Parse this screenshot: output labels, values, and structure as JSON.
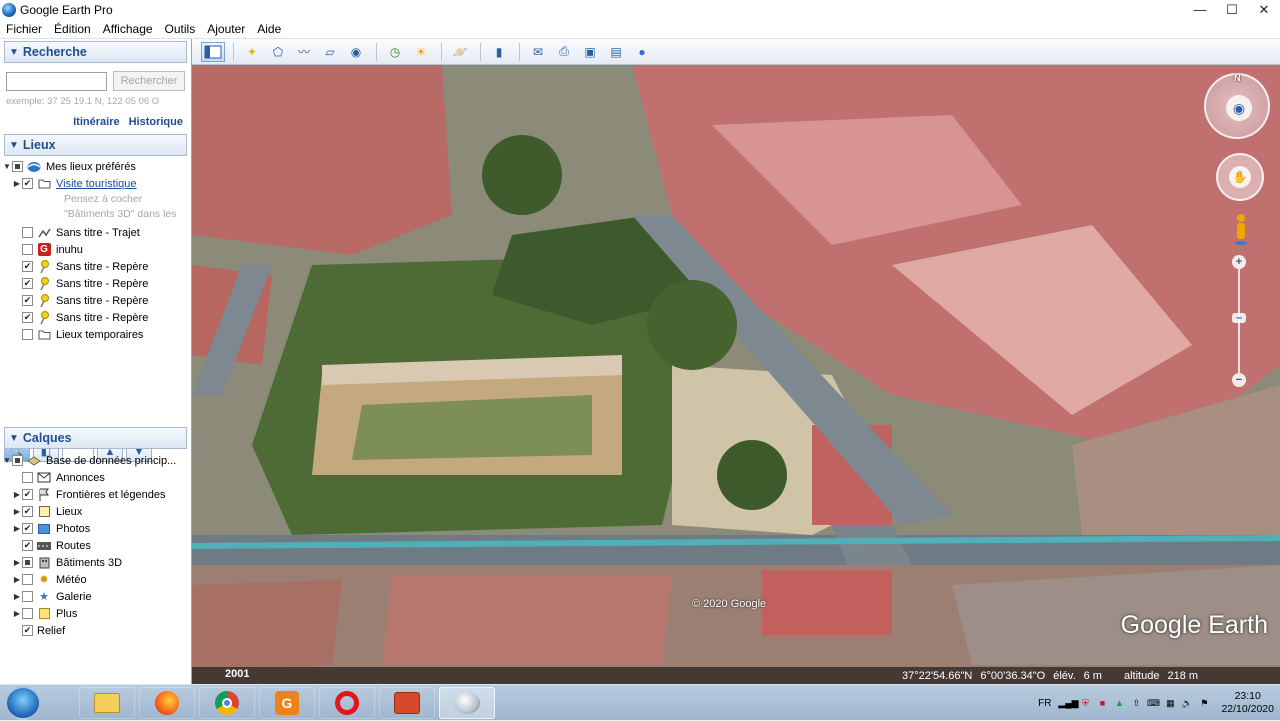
{
  "window": {
    "title": "Google Earth Pro",
    "icon": "google-earth-icon"
  },
  "menu": [
    "Fichier",
    "Édition",
    "Affichage",
    "Outils",
    "Ajouter",
    "Aide"
  ],
  "search": {
    "header": "Recherche",
    "input_value": "",
    "button_label": "Rechercher",
    "example": "exemple: 37 25 19.1 N, 122 05 06 O",
    "link_itinerary": "Itinéraire",
    "link_history": "Historique"
  },
  "places": {
    "header": "Lieux",
    "items": [
      {
        "label": "Mes lieux préférés",
        "icon": "globe-icon"
      },
      {
        "label": "Visite touristique",
        "icon": "folder-icon"
      },
      {
        "label": "Sans titre - Trajet",
        "icon": "path-icon"
      },
      {
        "label": "inuhu",
        "icon": "g-placemark-icon"
      },
      {
        "label": "Sans titre - Repère",
        "icon": "pushpin-icon"
      },
      {
        "label": "Sans titre - Repère",
        "icon": "pushpin-icon"
      },
      {
        "label": "Sans titre - Repère",
        "icon": "pushpin-icon"
      },
      {
        "label": "Sans titre - Repère",
        "icon": "pushpin-icon"
      },
      {
        "label": "Lieux temporaires",
        "icon": "folder-icon"
      }
    ],
    "tour_hint_1": "Pensez à cocher",
    "tour_hint_2": "\"Bâtiments 3D\" dans les"
  },
  "layers": {
    "header": "Calques",
    "items": [
      {
        "label": "Base de données princip...",
        "icon": "database-icon"
      },
      {
        "label": "Annonces",
        "icon": "envelope-icon"
      },
      {
        "label": "Frontières et légendes",
        "icon": "flag-icon"
      },
      {
        "label": "Lieux",
        "icon": "places-icon"
      },
      {
        "label": "Photos",
        "icon": "photo-icon"
      },
      {
        "label": "Routes",
        "icon": "road-icon"
      },
      {
        "label": "Bâtiments 3D",
        "icon": "building-icon"
      },
      {
        "label": "Météo",
        "icon": "weather-icon"
      },
      {
        "label": "Galerie",
        "icon": "star-icon"
      },
      {
        "label": "Plus",
        "icon": "more-icon"
      },
      {
        "label": "Relief",
        "icon": "terrain-icon"
      }
    ]
  },
  "map": {
    "copyright": "© 2020 Google",
    "brand": "Google Earth",
    "imagery_year": "2001",
    "lat": "37°22'54.66\"N",
    "lon": "6°00'36.34\"O",
    "elev_label": "élév.",
    "elev_value": "6 m",
    "alt_label": "altitude",
    "alt_value": "218 m",
    "north": "N"
  },
  "taskbar": {
    "apps": [
      "file-explorer-icon",
      "firefox-icon",
      "chrome-icon",
      "orange-app-icon",
      "opera-icon",
      "presentation-icon",
      "google-earth-task-icon"
    ],
    "lang": "FR",
    "time": "23:10",
    "date": "22/10/2020"
  }
}
